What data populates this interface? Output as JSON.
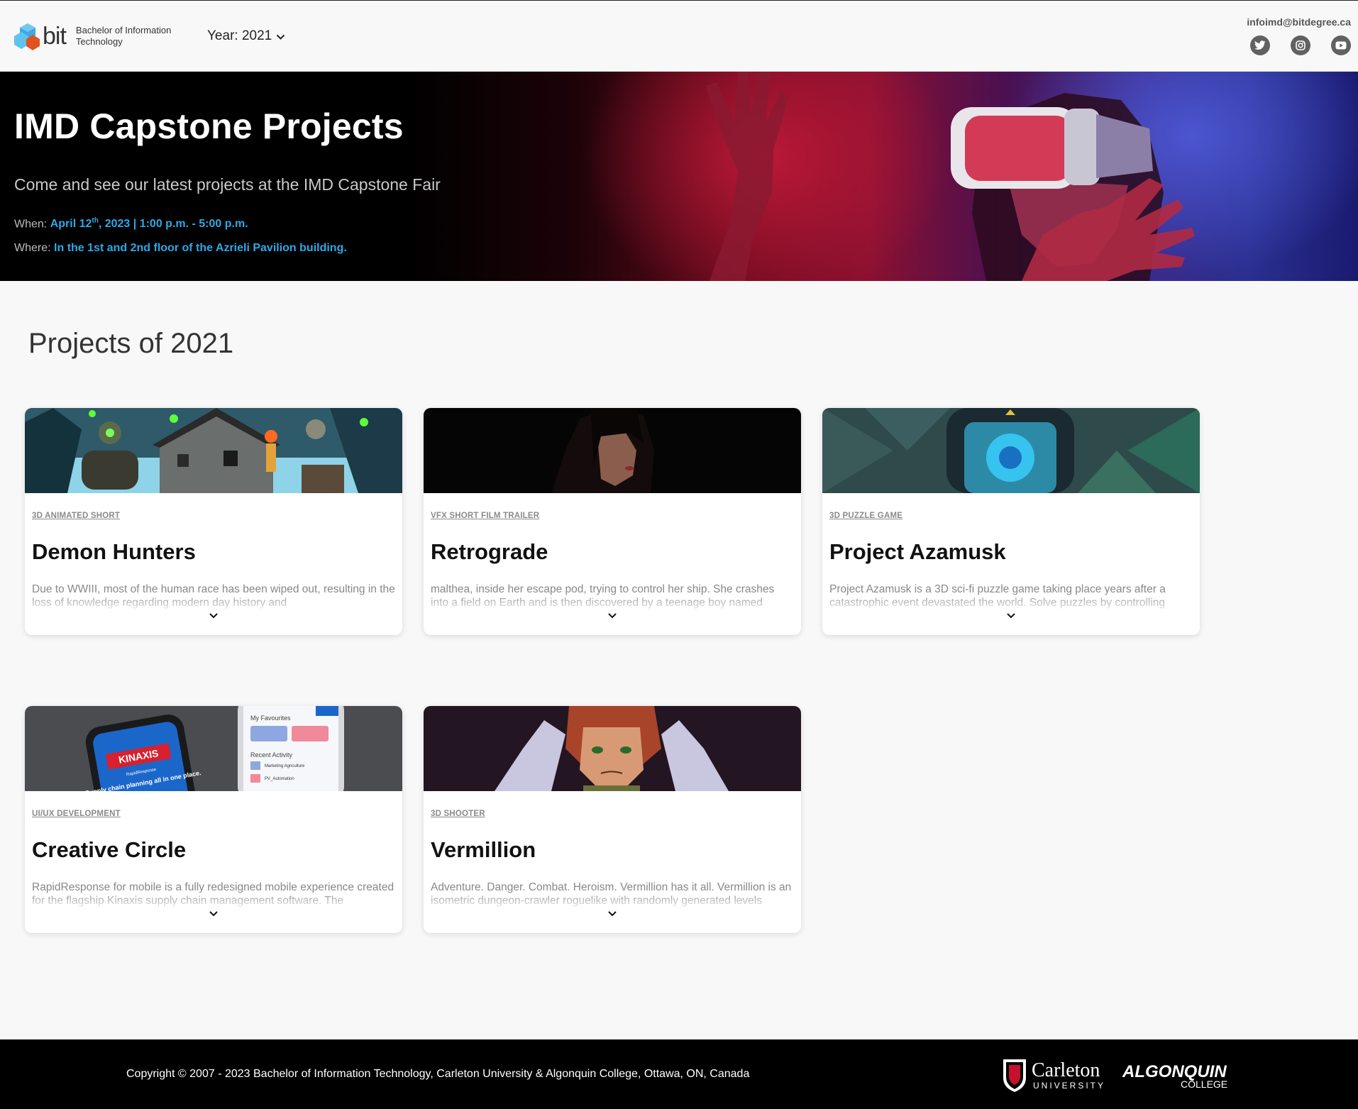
{
  "header": {
    "brand_word": "bit",
    "brand_line1": "Bachelor of Information",
    "brand_line2": "Technology",
    "year_label": "Year: 2021",
    "email": "infoimd@bitdegree.ca",
    "socials": [
      "twitter-icon",
      "instagram-icon",
      "youtube-icon"
    ]
  },
  "hero": {
    "title": "IMD Capstone Projects",
    "subtitle": "Come and see our latest projects at the IMD Capstone Fair",
    "when_label": "When:",
    "when_date_prefix": "April 12",
    "when_date_sup": "th",
    "when_date_rest": ", 2023 | 1:00 p.m. - 5:00 p.m.",
    "where_label": "Where:",
    "where_value": "In the 1st and 2nd floor of the Azrieli Pavilion building."
  },
  "section": {
    "title": "Projects of 2021"
  },
  "projects": [
    {
      "tag": "3D Animated Short",
      "title": "Demon Hunters",
      "desc": "Due to WWIII, most of the human race has been wiped out, resulting in the loss of knowledge regarding modern day history and"
    },
    {
      "tag": "VFX Short Film Trailer",
      "title": "Retrograde",
      "desc": "malthea, inside her escape pod, trying to control her ship. She crashes into a field on Earth and is then discovered by a teenage boy named"
    },
    {
      "tag": "3D Puzzle Game",
      "title": "Project Azamusk",
      "desc": "Project Azamusk is a 3D sci-fi puzzle game taking place years after a catastrophic event devastated the world. Solve puzzles by controlling"
    },
    {
      "tag": "UI/UX Development",
      "title": "Creative Circle",
      "desc": "RapidResponse for mobile is a fully redesigned mobile experience created for the flagship Kinaxis supply chain management software. The"
    },
    {
      "tag": "3D Shooter",
      "title": "Vermillion",
      "desc": "Adventure. Danger. Combat. Heroism. Vermillion has it all. Vermillion is an isometric dungeon-crawler roguelike with randomly generated levels"
    }
  ],
  "card_images": {
    "kinaxis_logo_text": "KINAXIS",
    "kinaxis_sub": "RapidResponse",
    "kinaxis_tagline": "Supply chain planning all in one place.",
    "phone_favourites": "My Favourites",
    "phone_recent": "Recent Activity",
    "phone_item1": "Marketing Agriculture",
    "phone_item2": "PV_Automation"
  },
  "footer": {
    "copyright": "Copyright © 2007 - 2023 Bachelor of Information Technology, Carleton University & Algonquin College, Ottawa, ON, Canada",
    "carleton_name": "Carleton",
    "carleton_sub": "UNIVERSITY",
    "algonquin_name": "ALGONQUIN",
    "algonquin_sub": "COLLEGE"
  }
}
